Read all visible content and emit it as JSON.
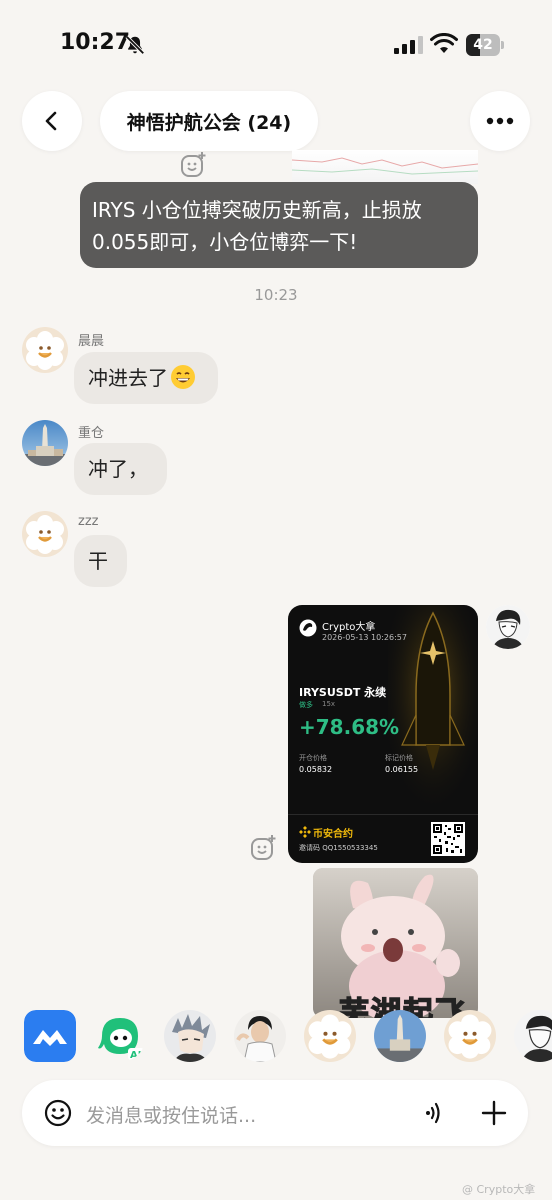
{
  "status_bar": {
    "time": "10:27",
    "battery": "42",
    "battery_level": 0.42
  },
  "header": {
    "title": "神悟护航公会 (24)"
  },
  "messages": {
    "dark_bubble": {
      "line1": "IRYS  小仓位搏突破历史新高，止损放",
      "line2": "0.055即可，小仓位博弈一下!"
    },
    "timestamp": "10:23",
    "items": [
      {
        "sender": "晨晨",
        "text": "冲进去了",
        "emoji": "grinning-face-emoji"
      },
      {
        "sender": "重仓",
        "text": "冲了，"
      },
      {
        "sender": "zzz",
        "text": "干"
      }
    ]
  },
  "trade_card": {
    "author": "Crypto大拿",
    "datetime": "2026-05-13 10:26:57",
    "pair": "IRYSUSDT 永续",
    "side": "做多",
    "leverage": "15x",
    "pnl": "+78.68%",
    "entry_label": "开仓价格",
    "entry_value": "0.05832",
    "mark_label": "标记价格",
    "mark_value": "0.06155",
    "brand": "币安合约",
    "invite": "邀请码 QQ1550533345",
    "accent_color": "#f0b90b",
    "pnl_color": "#2ebd85"
  },
  "sticker": {
    "caption": "芜湖起飞"
  },
  "input": {
    "placeholder": "发消息或按住说话..."
  },
  "watermark": "@ Crypto大拿"
}
